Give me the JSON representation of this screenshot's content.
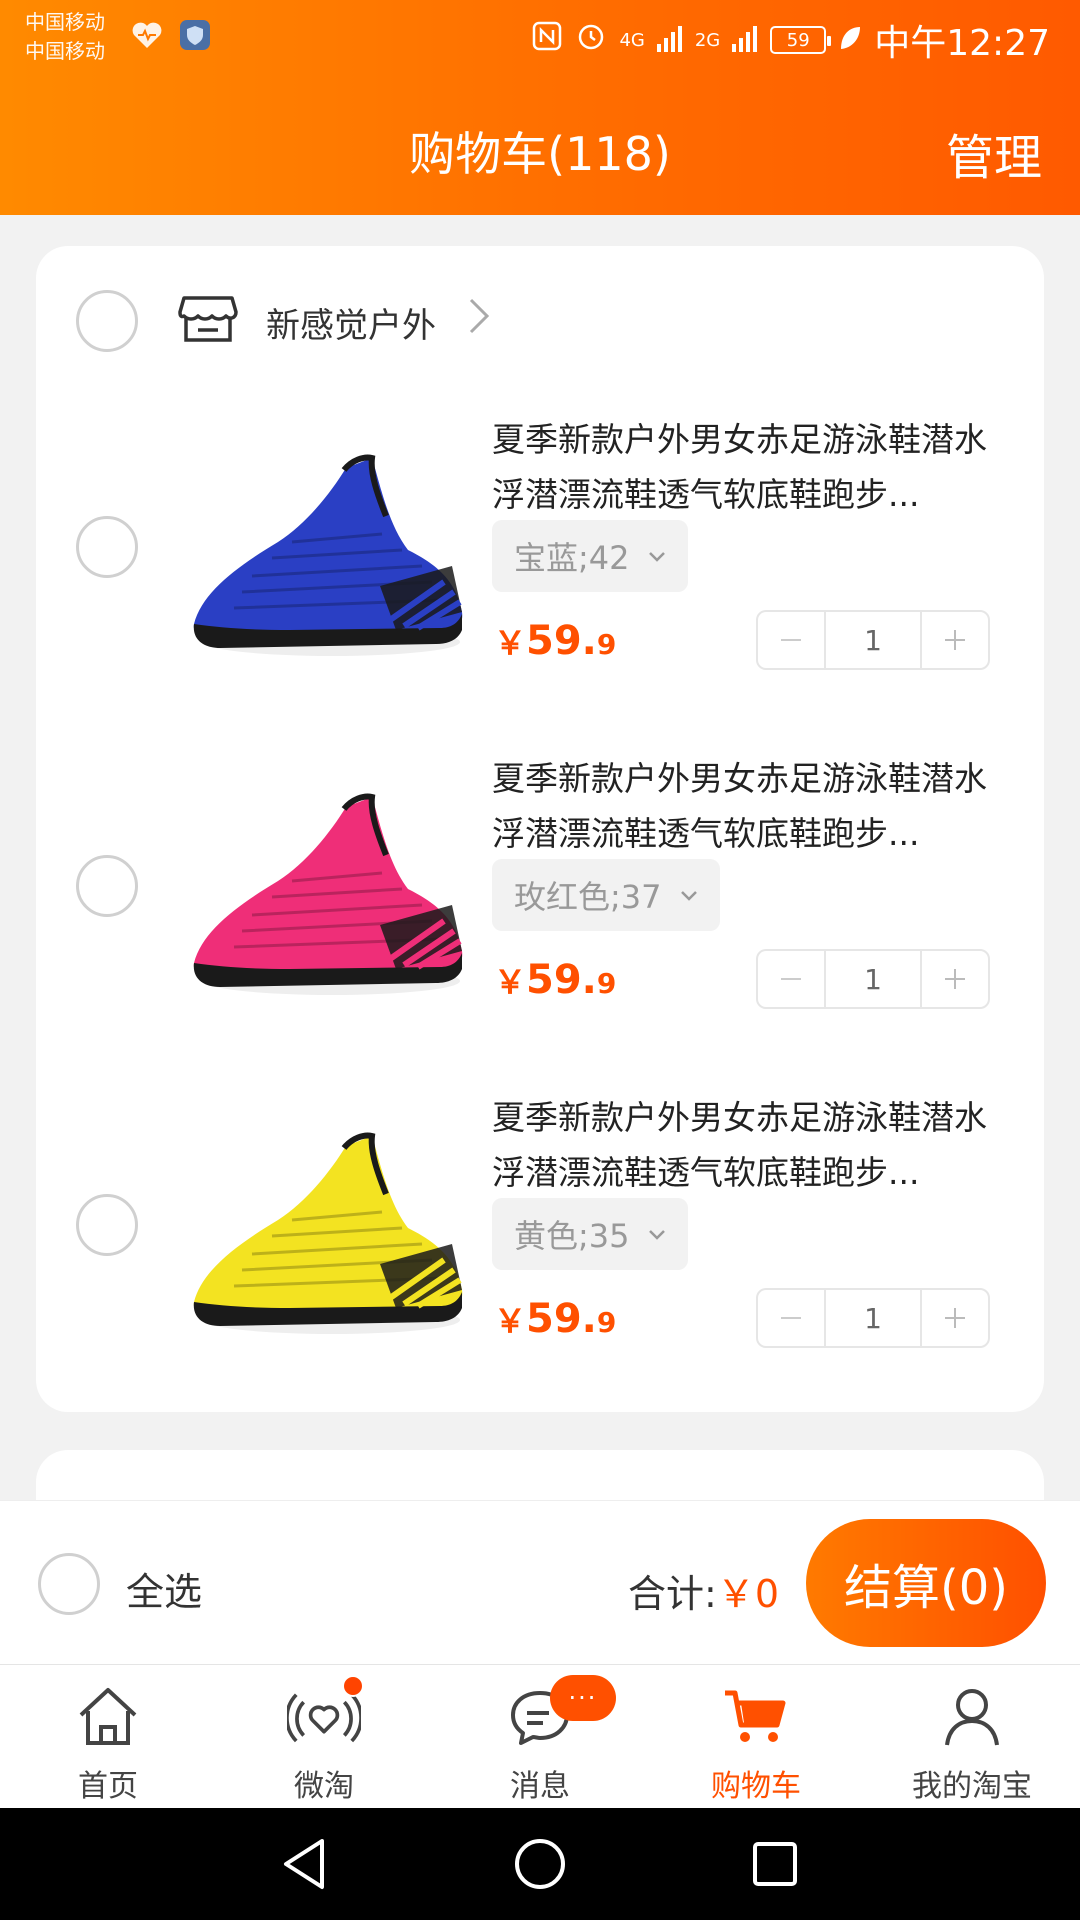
{
  "status_bar": {
    "carrier1": "中国移动",
    "carrier2": "中国移动",
    "net1": "4G",
    "net2": "2G",
    "battery": "59",
    "time": "中午12:27"
  },
  "header": {
    "title": "购物车(118)",
    "manage": "管理"
  },
  "store": {
    "name": "新感觉户外",
    "items": [
      {
        "title": "夏季新款户外男女赤足游泳鞋潜水浮潜漂流鞋透气软底鞋跑步...",
        "sku": "宝蓝;42",
        "price_currency": "￥",
        "price_int": "59.",
        "price_dec": "9",
        "qty": "1",
        "color": "#2a3fc4",
        "accent": "#1a1a1a"
      },
      {
        "title": "夏季新款户外男女赤足游泳鞋潜水浮潜漂流鞋透气软底鞋跑步...",
        "sku": "玫红色;37",
        "price_currency": "￥",
        "price_int": "59.",
        "price_dec": "9",
        "qty": "1",
        "color": "#ef2e78",
        "accent": "#1a1a1a"
      },
      {
        "title": "夏季新款户外男女赤足游泳鞋潜水浮潜漂流鞋透气软底鞋跑步...",
        "sku": "黄色;35",
        "price_currency": "￥",
        "price_int": "59.",
        "price_dec": "9",
        "qty": "1",
        "color": "#f3e321",
        "accent": "#1a1a1a"
      }
    ]
  },
  "checkout": {
    "select_all": "全选",
    "total_label": "合计:",
    "total_amount": "￥0",
    "button": "结算(0)"
  },
  "tabs": [
    {
      "label": "首页",
      "icon": "home-icon"
    },
    {
      "label": "微淘",
      "icon": "weitao-icon"
    },
    {
      "label": "消息",
      "icon": "message-icon",
      "badge": "···"
    },
    {
      "label": "购物车",
      "icon": "cart-icon",
      "active": true
    },
    {
      "label": "我的淘宝",
      "icon": "profile-icon"
    }
  ],
  "colors": {
    "brand": "#ff5000",
    "header_start": "#ff8a00",
    "header_end": "#ff5a00"
  }
}
